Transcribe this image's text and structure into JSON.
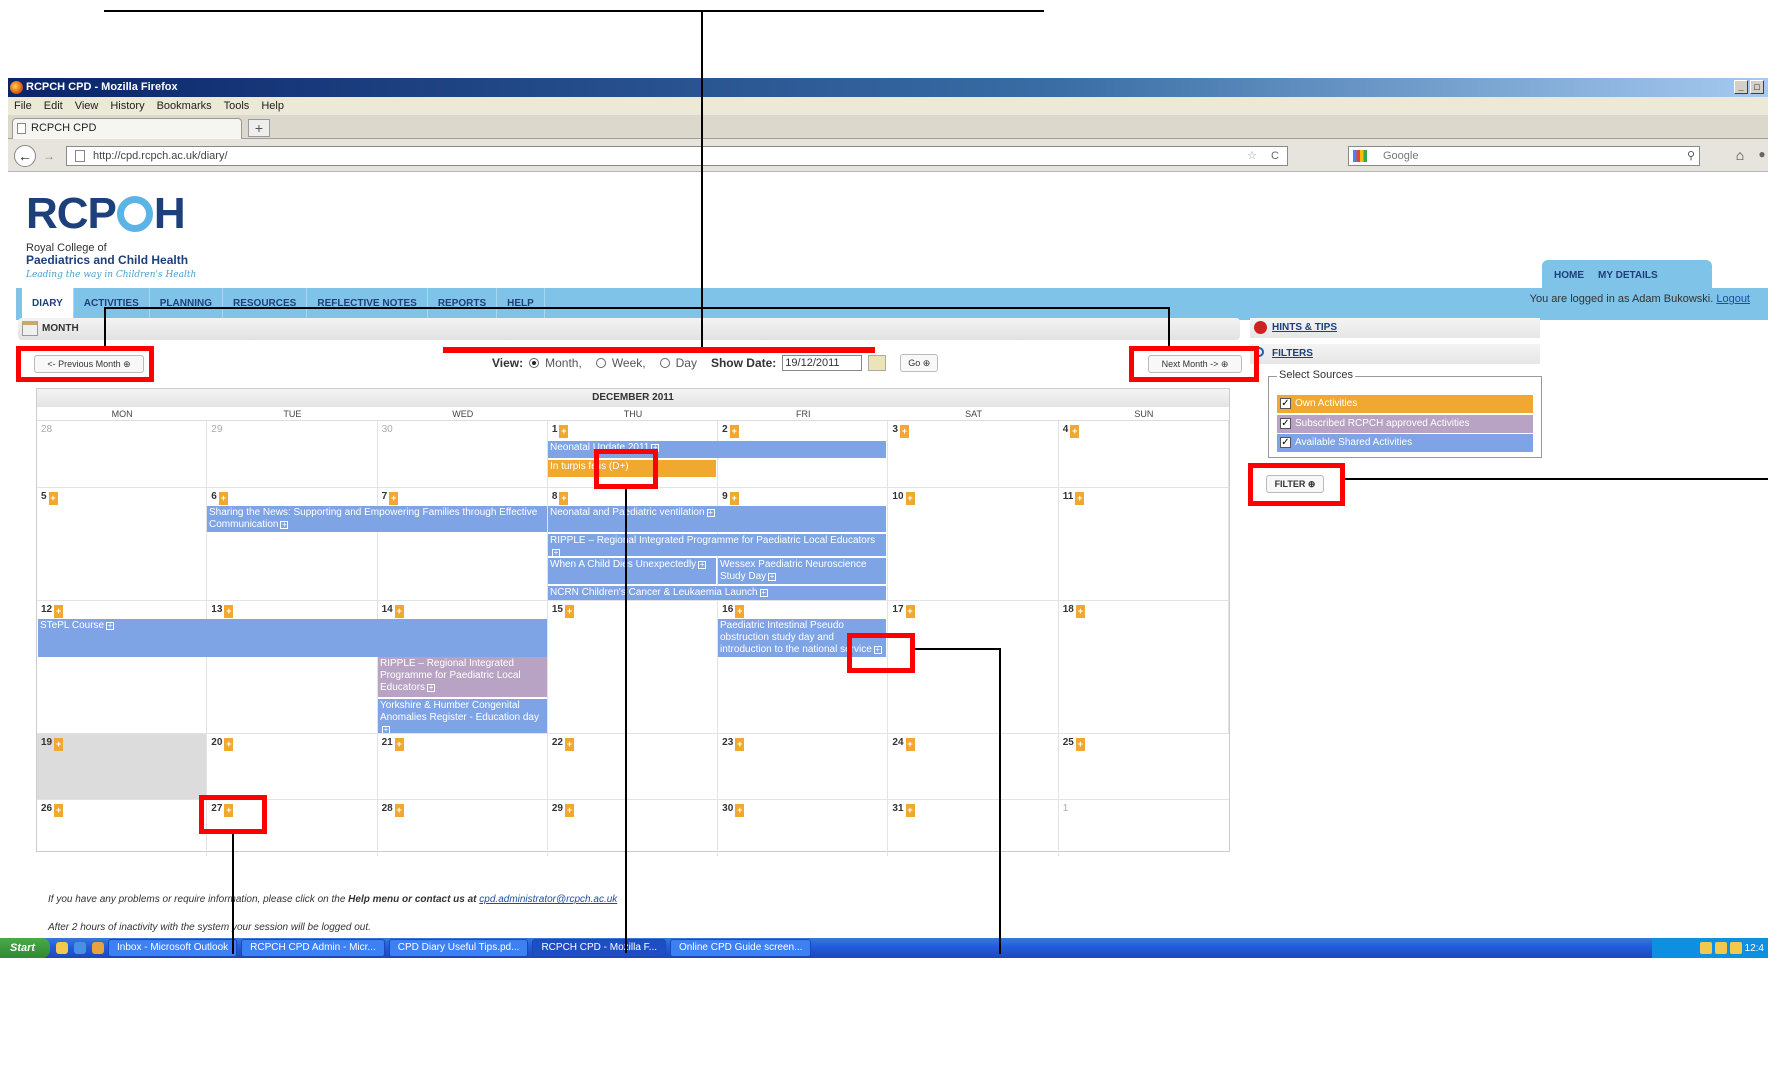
{
  "browser": {
    "window_title": "RCPCH CPD - Mozilla Firefox",
    "window_buttons": [
      "_",
      "□"
    ],
    "menu": [
      "File",
      "Edit",
      "View",
      "History",
      "Bookmarks",
      "Tools",
      "Help"
    ],
    "tab_title": "RCPCH CPD",
    "new_tab": "+",
    "url": "http://cpd.rcpch.ac.uk/diary/",
    "search_placeholder": "Google"
  },
  "site": {
    "logo_text_left": "RCP",
    "logo_text_right": "H",
    "logo_line1": "Royal College of",
    "logo_line2": "Paediatrics and Child Health",
    "logo_tagline": "Leading the way in Children's Health",
    "top_links": [
      "HOME",
      "MY DETAILS"
    ],
    "nav": [
      "DIARY",
      "ACTIVITIES",
      "PLANNING",
      "RESOURCES",
      "REFLECTIVE NOTES",
      "REPORTS",
      "HELP"
    ],
    "active_nav": "DIARY",
    "login_text": "You are logged in as Adam Bukowski.",
    "logout": "Logout"
  },
  "toolbar": {
    "section_title": "MONTH",
    "prev_month": "<- Previous Month ⊕",
    "next_month": "Next Month -> ⊕",
    "view_label": "View:",
    "view_month": "Month,",
    "view_week": "Week,",
    "view_day": "Day",
    "show_date_label": "Show Date:",
    "show_date_value": "19/12/2011",
    "go": "Go ⊕"
  },
  "calendar": {
    "month_title": "DECEMBER 2011",
    "day_headers": [
      "MON",
      "TUE",
      "WED",
      "THU",
      "FRI",
      "SAT",
      "SUN"
    ],
    "weeks": [
      [
        "28",
        "29",
        "30",
        "1",
        "2",
        "3",
        "4"
      ],
      [
        "5",
        "6",
        "7",
        "8",
        "9",
        "10",
        "11"
      ],
      [
        "12",
        "13",
        "14",
        "15",
        "16",
        "17",
        "18"
      ],
      [
        "19",
        "20",
        "21",
        "22",
        "23",
        "24",
        "25"
      ],
      [
        "26",
        "27",
        "28",
        "29",
        "30",
        "31",
        "1"
      ]
    ],
    "events": {
      "neonatal_update": "Neonatal Update 2011",
      "in_turpis": "In turpis felis (D+)",
      "sharing_news": "Sharing the News: Supporting and Empowering Families through Effective Communication",
      "neonatal_ventilation": "Neonatal and Paediatric ventilation",
      "ripple_1": "RIPPLE – Regional Integrated Programme for Paediatric Local Educators",
      "child_dies": "When A Child Dies Unexpectedly",
      "wessex": "Wessex Paediatric Neuroscience Study Day",
      "ncrn": "NCRN Children's Cancer & Leukaemia Launch",
      "stepl": "STePL Course",
      "intestinal": "Paediatric Intestinal Pseudo obstruction study day and introduction to the national service",
      "ripple_2": "RIPPLE – Regional Integrated Programme for Paediatric Local Educators",
      "yorkshire": "Yorkshire & Humber Congenital Anomalies Register - Education day"
    },
    "add_symbol": "+",
    "expand_symbol": "+"
  },
  "sidebar": {
    "hints": "HINTS & TIPS",
    "filters": "FILTERS",
    "sources_legend": "Select Sources",
    "sources": [
      {
        "label": "Own Activities",
        "checked": true,
        "color": "#f0a830"
      },
      {
        "label": "Subscribed RCPCH approved Activities",
        "checked": true,
        "color": "#b9a3c4"
      },
      {
        "label": "Available Shared Activities",
        "checked": true,
        "color": "#7fa4e6"
      }
    ],
    "filter_button": "FILTER ⊕"
  },
  "footer": {
    "line1_pre": "If you have any problems or require information, please click on the ",
    "line1_bold": "Help menu or contact us at",
    "line1_email": "cpd.administrator@rcpch.ac.uk",
    "line2": "After 2 hours of inactivity with the system your session will be logged out."
  },
  "taskbar": {
    "start": "Start",
    "tasks": [
      "Inbox - Microsoft Outlook",
      "RCPCH CPD Admin - Micr...",
      "CPD Diary Useful Tips.pd...",
      "RCPCH CPD - Mozilla F...",
      "Online CPD Guide screen..."
    ],
    "active_task": "RCPCH CPD - Mozilla F...",
    "clock": "12:4"
  },
  "colors": {
    "nav_blue": "#7fc3e8",
    "event_blue": "#7fa4e6",
    "event_orange": "#f0a830",
    "event_purple": "#b9a3c4",
    "annotation_red": "#ff0000"
  }
}
